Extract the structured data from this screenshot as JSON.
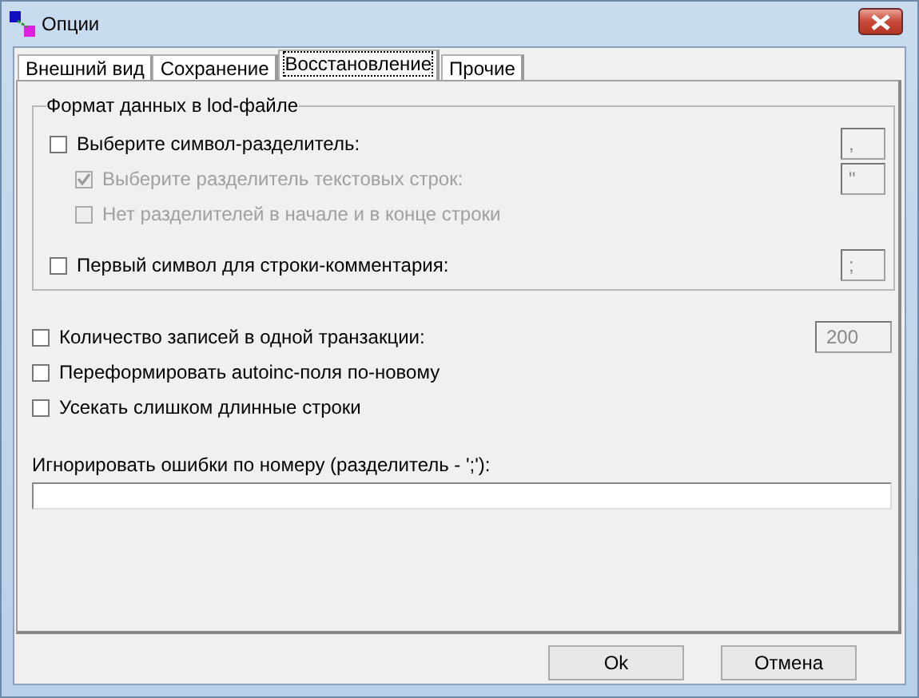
{
  "window": {
    "title": "Опции"
  },
  "tabs": [
    {
      "label": "Внешний вид",
      "selected": false
    },
    {
      "label": "Сохранение",
      "selected": false
    },
    {
      "label": "Восстановление",
      "selected": true
    },
    {
      "label": "Прочие",
      "selected": false
    }
  ],
  "group": {
    "title": "Формат данных в lod-файле",
    "options": [
      {
        "label": "Выберите символ-разделитель:",
        "checked": false,
        "disabled": false,
        "value": ",",
        "children": [
          {
            "label": "Выберите разделитель текстовых строк:",
            "checked": true,
            "disabled": true,
            "value": "\""
          },
          {
            "label": "Нет разделителей в начале и в конце строки",
            "checked": false,
            "disabled": true
          }
        ]
      },
      {
        "label": "Первый символ для строки-комментария:",
        "checked": false,
        "disabled": false,
        "value": ";"
      }
    ]
  },
  "options": [
    {
      "label": "Количество записей в одной транзакции:",
      "checked": false,
      "value": "200"
    },
    {
      "label": "Переформировать autoinc-поля по-новому",
      "checked": false
    },
    {
      "label": "Усекать слишком длинные строки",
      "checked": false
    }
  ],
  "ignore": {
    "label": "Игнорировать ошибки по номеру (разделитель - ';'):"
  },
  "buttons": [
    "Ok",
    "Отмена"
  ]
}
